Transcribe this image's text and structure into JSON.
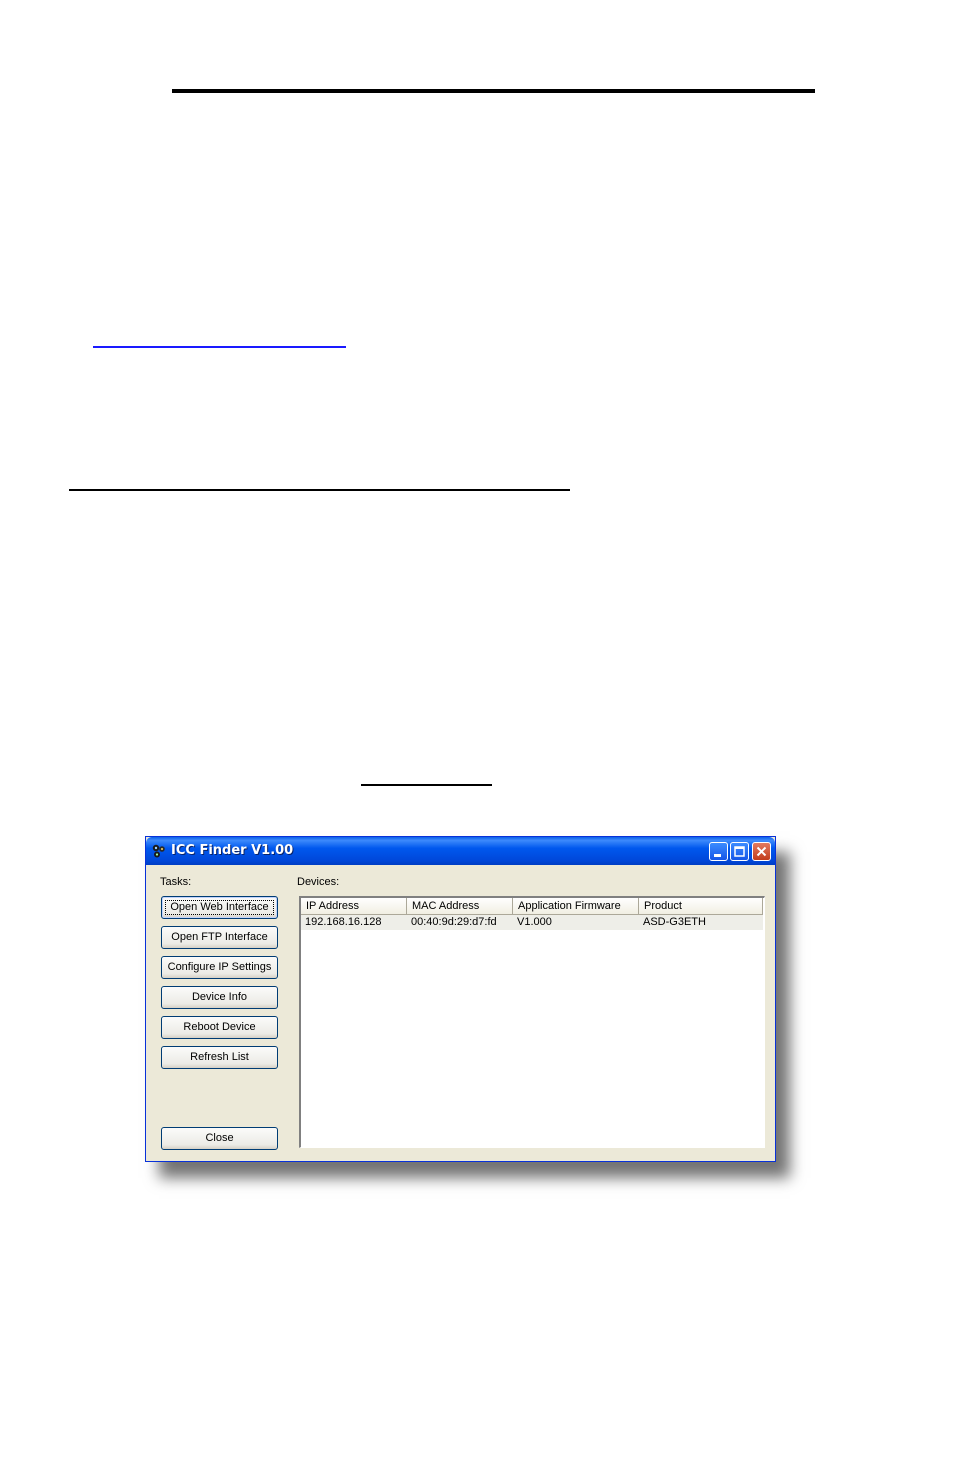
{
  "window": {
    "title": "ICC Finder V1.00",
    "tasks_label": "Tasks:",
    "devices_label": "Devices:"
  },
  "buttons": {
    "open_web": "Open Web Interface",
    "open_ftp": "Open FTP Interface",
    "configure_ip": "Configure IP Settings",
    "device_info": "Device Info",
    "reboot": "Reboot Device",
    "refresh": "Refresh List",
    "close": "Close"
  },
  "table": {
    "columns": [
      "IP Address",
      "MAC Address",
      "Application Firmware",
      "Product"
    ],
    "rows": [
      [
        "192.168.16.128",
        "00:40:9d:29:d7:fd",
        "V1.000",
        "ASD-G3ETH"
      ]
    ]
  },
  "colors": {
    "titlebar": "#0054e3",
    "window_face": "#ece9d8",
    "close_button": "#c23d1c"
  }
}
